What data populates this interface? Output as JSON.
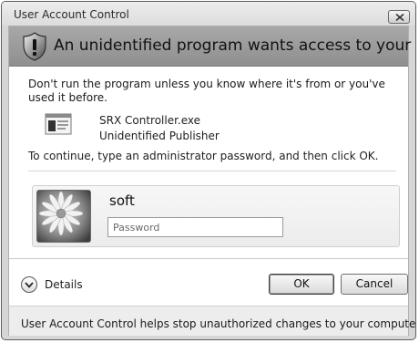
{
  "window": {
    "title": "User Account Control",
    "close_icon": "close-icon"
  },
  "banner": {
    "icon": "shield-warning-icon",
    "heading": "An unidentified program wants access to your computer"
  },
  "message": "Don't run the program unless you know where it's from or you've used it before.",
  "program": {
    "icon": "program-icon",
    "name": "SRX Controller.exe",
    "publisher": "Unidentified Publisher"
  },
  "instruction": "To continue, type an administrator password, and then click OK.",
  "credential": {
    "avatar": "flower-avatar",
    "username": "soft",
    "password_placeholder": "Password"
  },
  "footer": {
    "details_label": "Details",
    "ok_label": "OK",
    "cancel_label": "Cancel",
    "note": "User Account Control helps stop unauthorized changes to your computer."
  }
}
